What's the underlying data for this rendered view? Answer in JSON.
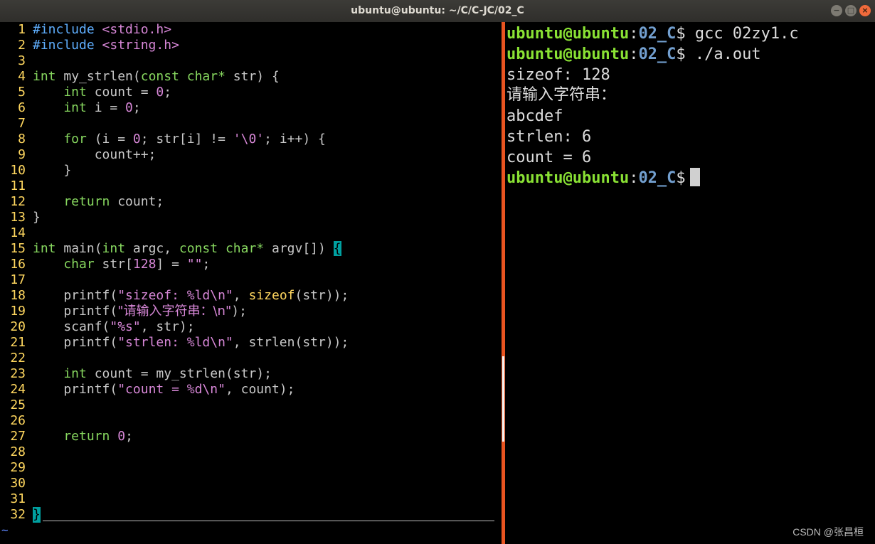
{
  "window": {
    "title": "ubuntu@ubuntu: ~/C/C-JC/02_C",
    "buttons": {
      "minimize": "−",
      "maximize": "□",
      "close": "×"
    }
  },
  "editor": {
    "lines": [
      {
        "n": "1"
      },
      {
        "n": "2"
      },
      {
        "n": "3"
      },
      {
        "n": "4"
      },
      {
        "n": "5"
      },
      {
        "n": "6"
      },
      {
        "n": "7"
      },
      {
        "n": "8"
      },
      {
        "n": "9"
      },
      {
        "n": "10"
      },
      {
        "n": "11"
      },
      {
        "n": "12"
      },
      {
        "n": "13"
      },
      {
        "n": "14"
      },
      {
        "n": "15"
      },
      {
        "n": "16"
      },
      {
        "n": "17"
      },
      {
        "n": "18"
      },
      {
        "n": "19"
      },
      {
        "n": "20"
      },
      {
        "n": "21"
      },
      {
        "n": "22"
      },
      {
        "n": "23"
      },
      {
        "n": "24"
      },
      {
        "n": "25"
      },
      {
        "n": "26"
      },
      {
        "n": "27"
      },
      {
        "n": "28"
      },
      {
        "n": "29"
      },
      {
        "n": "30"
      },
      {
        "n": "31"
      },
      {
        "n": "32"
      }
    ],
    "code": {
      "l1_a": "#include",
      "l1_b": " <stdio.h>",
      "l2_a": "#include",
      "l2_b": " <string.h>",
      "l4_a": "int",
      "l4_b": " my_strlen(",
      "l4_c": "const char*",
      "l4_d": " str) {",
      "l5_a": "    int",
      "l5_b": " count = ",
      "l5_c": "0",
      "l5_d": ";",
      "l6_a": "    int",
      "l6_b": " i = ",
      "l6_c": "0",
      "l6_d": ";",
      "l8_a": "    for",
      "l8_b": " (i = ",
      "l8_c": "0",
      "l8_d": "; str[i] != ",
      "l8_e": "'\\0'",
      "l8_f": "; i++) {",
      "l9": "        count++;",
      "l10": "    }",
      "l12_a": "    return",
      "l12_b": " count;",
      "l13": "}",
      "l15_a": "int",
      "l15_b": " main(",
      "l15_c": "int",
      "l15_d": " argc, ",
      "l15_e": "const char*",
      "l15_f": " argv[]) ",
      "l15_g": "{",
      "l16_a": "    char",
      "l16_b": " str[",
      "l16_c": "128",
      "l16_d": "] = ",
      "l16_e": "\"\"",
      "l16_f": ";",
      "l18_a": "    printf(",
      "l18_b": "\"sizeof: %ld\\n\"",
      "l18_c": ", ",
      "l18_d": "sizeof",
      "l18_e": "(str));",
      "l19_a": "    printf(",
      "l19_b": "\"请输入字符串：\\n\"",
      "l19_c": ");",
      "l20_a": "    scanf(",
      "l20_b": "\"%s\"",
      "l20_c": ", str);",
      "l21_a": "    printf(",
      "l21_b": "\"strlen: %ld\\n\"",
      "l21_c": ", strlen(str));",
      "l23_a": "    int",
      "l23_b": " count = my_strlen(str);",
      "l24_a": "    printf(",
      "l24_b": "\"count = %d\\n\"",
      "l24_c": ", count);",
      "l27_a": "    return",
      "l27_b": " ",
      "l27_c": "0",
      "l27_d": ";",
      "l32": "}"
    },
    "tilde": "~"
  },
  "terminal": {
    "user": "ubuntu@ubuntu",
    "sep": ":",
    "path": "02_C",
    "prompt": "$",
    "cmd1": " gcc 02zy1.c",
    "cmd2": " ./a.out",
    "out1": "sizeof: 128",
    "out2": "请输入字符串：",
    "out3": "abcdef",
    "out4": "strlen: 6",
    "out5": "count = 6"
  },
  "watermark": "CSDN @张昌桓"
}
